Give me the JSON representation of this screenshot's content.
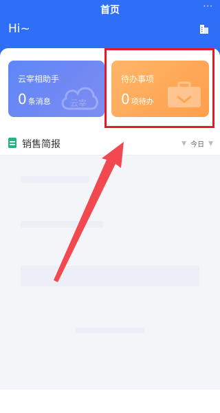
{
  "header": {
    "title": "首页",
    "more": "···",
    "greeting": "Hi~"
  },
  "cards": {
    "assistant": {
      "title": "云宰相助手",
      "count": "0",
      "unit": "条消息",
      "watermark": "云宰"
    },
    "todo": {
      "title": "待办事项",
      "count": "0",
      "unit": "项待办"
    }
  },
  "sales": {
    "title": "销售简报",
    "period": "今日"
  },
  "colors": {
    "header_bg": "#2f6ef6",
    "assistant_card": "#6f8af5",
    "todo_card": "#ffaa5a",
    "highlight": "#e21b2c",
    "arrow": "#f2484f"
  },
  "icons": [
    "more-icon",
    "building-icon",
    "cloud-icon",
    "briefcase-icon",
    "document-icon",
    "caret-down-icon"
  ]
}
